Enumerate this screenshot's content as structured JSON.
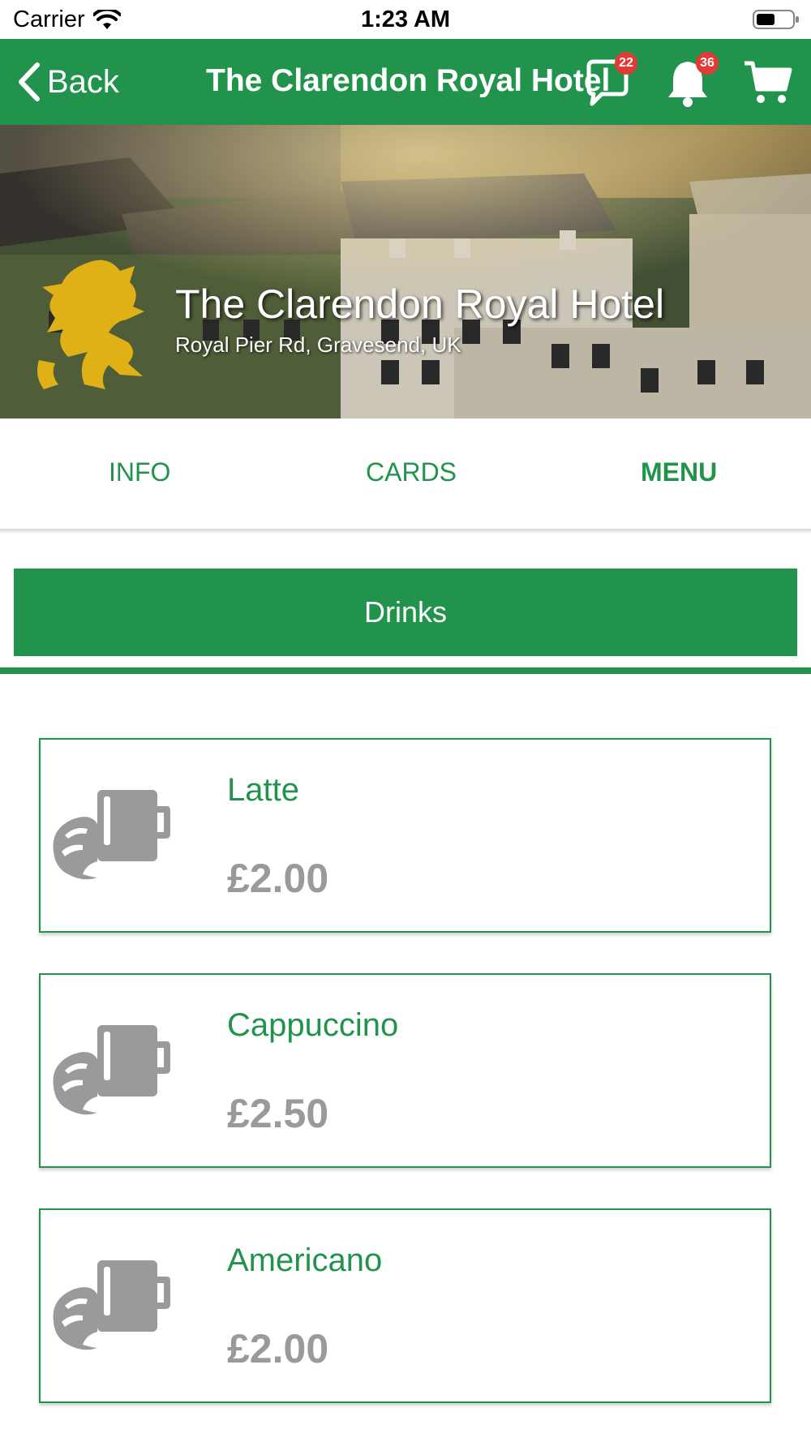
{
  "status_bar": {
    "carrier": "Carrier",
    "time": "1:23 AM"
  },
  "nav": {
    "back_label": "Back",
    "title": "The Clarendon Royal Hotel",
    "chat_badge": "22",
    "notification_badge": "36",
    "accent_color": "#22934c",
    "badge_color": "#e53935",
    "icons": [
      "chevron-left-icon",
      "chat-icon",
      "bell-icon",
      "cart-icon"
    ]
  },
  "hero": {
    "name": "The Clarendon Royal Hotel",
    "address": "Royal Pier Rd, Gravesend, UK",
    "logo_color": "#e0b117"
  },
  "tabs": [
    {
      "label": "INFO",
      "active": false
    },
    {
      "label": "CARDS",
      "active": false
    },
    {
      "label": "MENU",
      "active": true
    }
  ],
  "category": {
    "label": "Drinks"
  },
  "items": [
    {
      "name": "Latte",
      "price": "£2.00",
      "icon": "croissant-cup-icon"
    },
    {
      "name": "Cappuccino",
      "price": "£2.50",
      "icon": "croissant-cup-icon"
    },
    {
      "name": "Americano",
      "price": "£2.00",
      "icon": "croissant-cup-icon"
    }
  ]
}
